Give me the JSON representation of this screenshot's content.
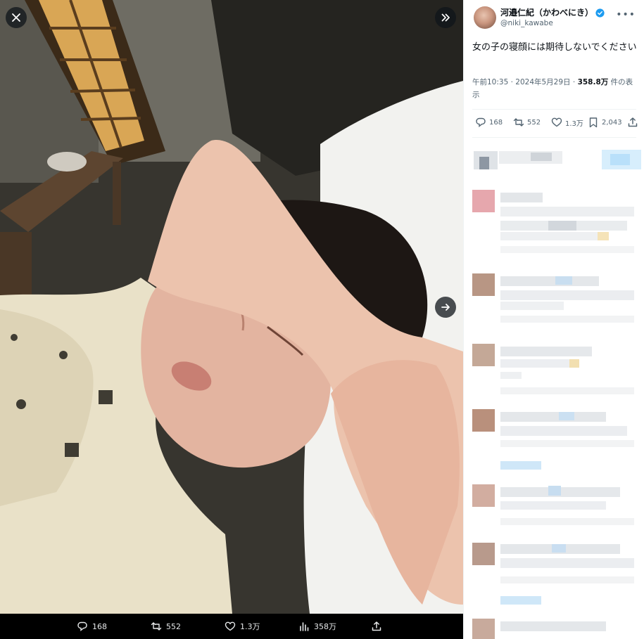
{
  "author": {
    "display_name": "河邉仁紀（かわべにき）",
    "handle": "@niki_kawabe",
    "more_icon": "more-dots-icon",
    "verified_color": "#1d9bf0"
  },
  "tweet": {
    "text": "女の子の寝顔には期待しないでください",
    "time": "午前10:35 · 2024年5月29日 · ",
    "views_count": "358.8万",
    "views_label": " 件の表示"
  },
  "actions": {
    "replies": "168",
    "retweets": "552",
    "likes": "1.3万",
    "bookmarks": "2,043"
  },
  "media_bar": {
    "replies": "168",
    "retweets": "552",
    "likes": "1.3万",
    "views": "358万"
  },
  "controls": {
    "close_icon": "close-icon",
    "expand_icon": "chevrons-right-icon",
    "next_icon": "arrow-right-icon"
  },
  "colors": {
    "accent": "#1d9bf0",
    "text_primary": "#0f1419",
    "text_secondary": "#536471"
  }
}
